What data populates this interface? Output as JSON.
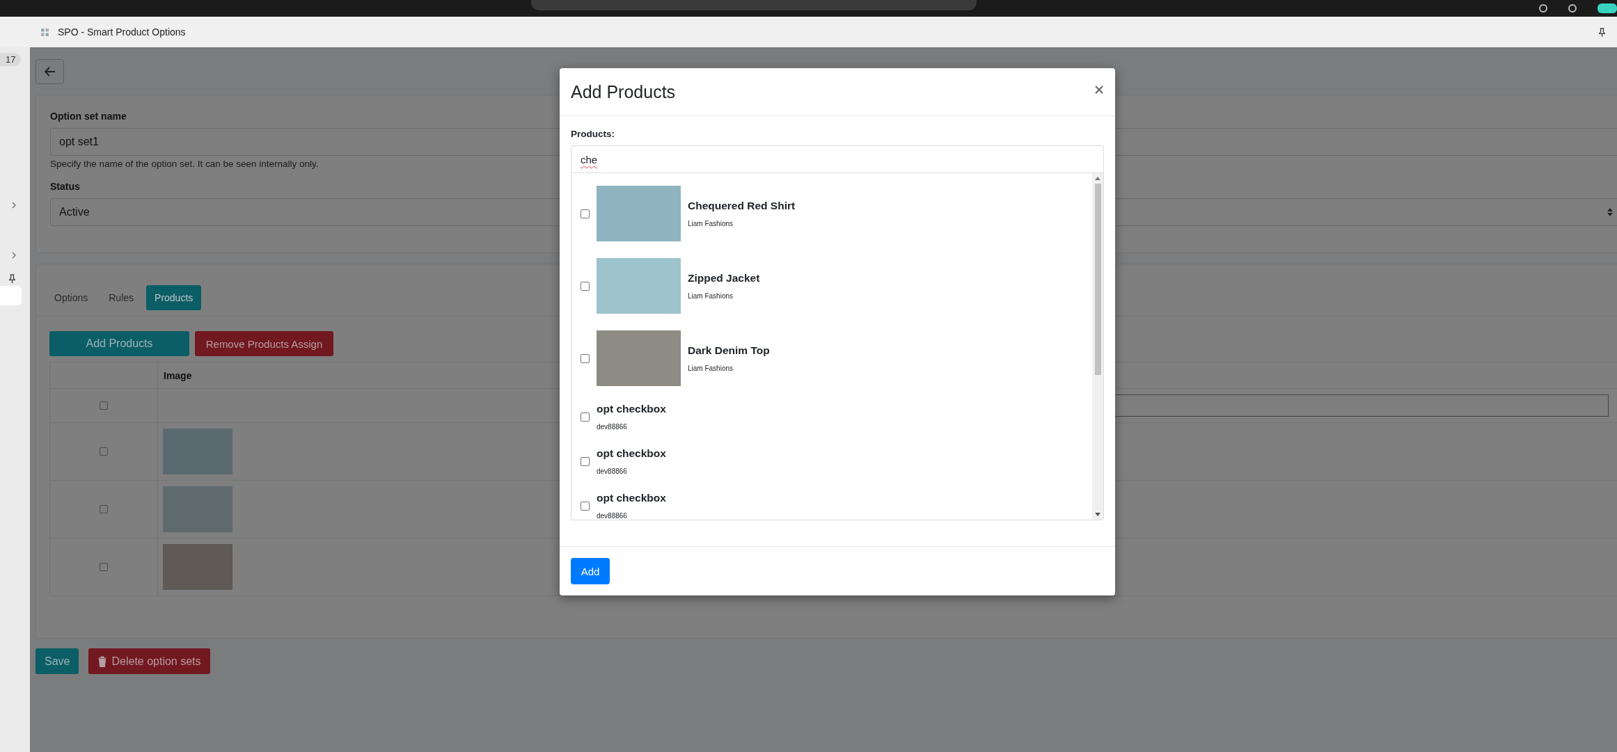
{
  "app_bar": {
    "title": "SPO - Smart Product Options"
  },
  "sidebar": {
    "badge": "17"
  },
  "form": {
    "name_field": {
      "label": "Option set name",
      "value": "opt set1",
      "help": "Specify the name of the option set. It can be seen internally only."
    },
    "status_field": {
      "label": "Status",
      "value": "Active"
    }
  },
  "tabs": [
    {
      "label": "Options",
      "selected": false
    },
    {
      "label": "Rules",
      "selected": false
    },
    {
      "label": "Products",
      "selected": true
    }
  ],
  "actions": [
    {
      "label": "Add Products",
      "kind": "primary"
    },
    {
      "label": "Remove Products Assign",
      "kind": "danger"
    }
  ],
  "table": {
    "columns": [
      "Image"
    ],
    "select_all": {
      "checked": false
    },
    "rows": [
      {
        "checked": false
      },
      {
        "checked": false
      },
      {
        "checked": false
      }
    ]
  },
  "footer_buttons": [
    {
      "label": "Save",
      "kind": "primary"
    },
    {
      "label": "Delete option sets",
      "kind": "danger"
    }
  ],
  "modal": {
    "title": "Add Products",
    "field_label": "Products:",
    "search": {
      "value": "che"
    },
    "products": [
      {
        "kind": "image",
        "name": "Chequered Red Shirt",
        "vendor": "Liam Fashions",
        "checked": false
      },
      {
        "kind": "image",
        "name": "Zipped Jacket",
        "vendor": "Liam Fashions",
        "checked": false
      },
      {
        "kind": "image",
        "name": "Dark Denim Top",
        "vendor": "Liam Fashions",
        "checked": false
      },
      {
        "kind": "text",
        "name": "opt checkbox",
        "vendor": "dev88866",
        "checked": false
      },
      {
        "kind": "text",
        "name": "opt checkbox",
        "vendor": "dev88866",
        "checked": false
      },
      {
        "kind": "text",
        "name": "opt checkbox",
        "vendor": "dev88866",
        "checked": false
      }
    ],
    "button": "Add"
  }
}
